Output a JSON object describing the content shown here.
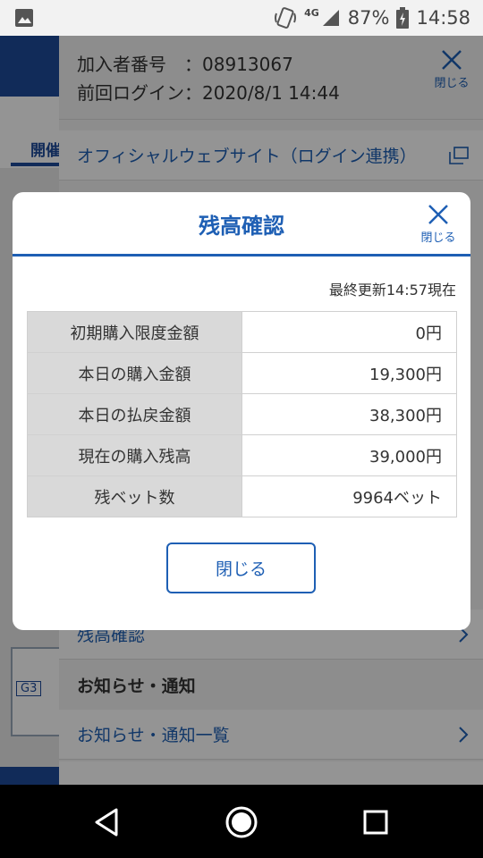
{
  "status_bar": {
    "network": "4G",
    "battery": "87%",
    "time": "14:58"
  },
  "menu": {
    "member_id": "加入者番号　：08913067",
    "last_login": "前回ログイン：2020/8/1 14:44",
    "close_label": "閉じる",
    "official_site": "オフィシャルウェブサイト（ログイン連携）",
    "balance_item": "残高確認",
    "notice_section": "お知らせ・通知",
    "notice_list": "お知らせ・通知一覧"
  },
  "background": {
    "tab_fragment": "開催",
    "grade_badge": "G3"
  },
  "modal": {
    "title": "残高確認",
    "close_label": "閉じる",
    "updated": "最終更新14:57現在",
    "rows": [
      {
        "label": "初期購入限度金額",
        "value": "0円"
      },
      {
        "label": "本日の購入金額",
        "value": "19,300円"
      },
      {
        "label": "本日の払戻金額",
        "value": "38,300円"
      },
      {
        "label": "現在の購入残高",
        "value": "39,000円"
      },
      {
        "label": "残ベット数",
        "value": "9964ベット"
      }
    ],
    "close_button": "閉じる"
  },
  "colors": {
    "accent": "#1e5fb4",
    "header_cell": "#d9d9d9"
  }
}
